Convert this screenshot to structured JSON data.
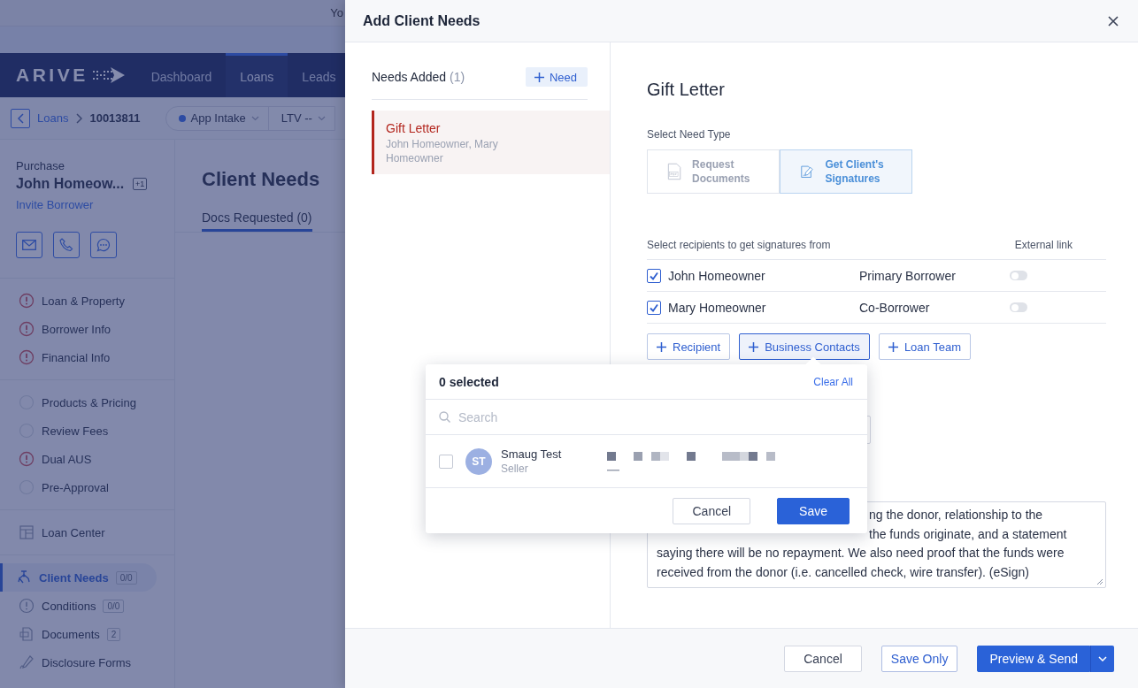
{
  "background_page": {
    "top_bar": {
      "text": "Yo"
    },
    "logo": "ARIVE",
    "nav_tabs": [
      {
        "label": "Dashboard",
        "selected": false
      },
      {
        "label": "Loans",
        "selected": true
      },
      {
        "label": "Leads",
        "selected": false
      }
    ],
    "breadcrumb": {
      "parent": "Loans",
      "current": "10013811"
    },
    "status_pill": {
      "stage": "App Intake",
      "ltv": "LTV --"
    },
    "loan": {
      "type": "Purchase",
      "borrower": "John Homeow...",
      "extra_badge": "+1",
      "invite_link": "Invite Borrower"
    },
    "sidebar_groups": [
      [
        {
          "label": "Loan & Property",
          "kind": "warning",
          "selected": false
        },
        {
          "label": "Borrower Info",
          "kind": "warning",
          "selected": false
        },
        {
          "label": "Financial Info",
          "kind": "warning",
          "selected": false
        }
      ],
      [
        {
          "label": "Products & Pricing",
          "kind": "pending",
          "selected": false
        },
        {
          "label": "Review Fees",
          "kind": "pending",
          "selected": false
        },
        {
          "label": "Dual AUS",
          "kind": "warning",
          "selected": false
        },
        {
          "label": "Pre-Approval",
          "kind": "pending",
          "selected": false
        }
      ],
      [
        {
          "label": "Loan Center",
          "kind": "layout",
          "selected": false
        }
      ],
      [
        {
          "label": "Client Needs",
          "kind": "needs",
          "badge": "0/0",
          "selected": true
        },
        {
          "label": "Conditions",
          "kind": "conditions",
          "badge": "0/0",
          "selected": false
        },
        {
          "label": "Documents",
          "kind": "documents",
          "badge": "2",
          "selected": false
        },
        {
          "label": "Disclosure Forms",
          "kind": "forms",
          "selected": false
        }
      ]
    ],
    "content": {
      "title": "Client Needs",
      "tabs": [
        {
          "label": "Docs Requested (0)",
          "selected": true
        }
      ]
    }
  },
  "drawer": {
    "title": "Add Client Needs",
    "needs_panel": {
      "title": "Needs Added",
      "count": "(1)",
      "add_button": "Need",
      "items": [
        {
          "title": "Gift Letter",
          "subtitle": "John Homeowner, Mary Homeowner",
          "selected": true
        }
      ]
    },
    "detail": {
      "title": "Gift Letter",
      "need_type_label": "Select Need Type",
      "need_types": [
        {
          "label": "Request Documents",
          "kind": "pdf",
          "selected": false
        },
        {
          "label": "Get Client's Signatures",
          "kind": "sign",
          "selected": true
        }
      ],
      "recipients_heading": "Select recipients to get signatures from",
      "external_link_heading": "External link",
      "recipients": [
        {
          "name": "John Homeowner",
          "role": "Primary Borrower",
          "checked": true,
          "external_link": false
        },
        {
          "name": "Mary Homeowner",
          "role": "Co-Borrower",
          "checked": true,
          "external_link": false
        }
      ],
      "add_buttons": [
        {
          "label": "Recipient",
          "active": false
        },
        {
          "label": "Business Contacts",
          "active": true
        },
        {
          "label": "Loan Team",
          "active": false
        }
      ],
      "description_lines": [
        {
          "text": "ng the donor, relationship to the",
          "covered": true
        },
        {
          "text": "the funds originate, and a statement",
          "covered": true
        },
        {
          "text": "saying there will be no repayment. We also need proof that the funds were",
          "covered": false
        },
        {
          "text": "received from the donor (i.e. cancelled check, wire transfer). (eSign)",
          "covered": false
        }
      ]
    },
    "popover": {
      "count": "0 selected",
      "clear": "Clear All",
      "search_placeholder": "Search",
      "contacts": [
        {
          "initials": "ST",
          "name": "Smaug Test",
          "role": "Seller",
          "checked": false
        }
      ],
      "cancel": "Cancel",
      "save": "Save"
    },
    "footer": {
      "cancel": "Cancel",
      "save_only": "Save Only",
      "send": "Preview & Send"
    }
  }
}
